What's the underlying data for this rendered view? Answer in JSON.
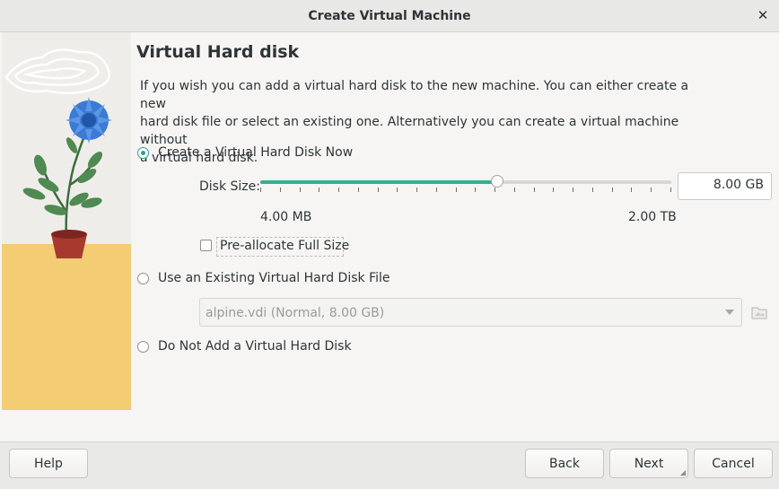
{
  "window": {
    "title": "Create Virtual Machine"
  },
  "page": {
    "title": "Virtual Hard disk",
    "description_lines": [
      "If you wish you can add a virtual hard disk to the new machine. You can either create a new",
      "hard disk file or select an existing one. Alternatively you can create a virtual machine without",
      "a virtual hard disk."
    ]
  },
  "options": {
    "create_new": {
      "label": "Create a Virtual Hard Disk Now",
      "selected": true
    },
    "use_existing": {
      "label": "Use an Existing Virtual Hard Disk File",
      "selected": false
    },
    "no_disk": {
      "label": "Do Not Add a Virtual Hard Disk",
      "selected": false
    }
  },
  "disk_size": {
    "label": "Disk Size:",
    "value": "8.00 GB",
    "min_label": "4.00 MB",
    "max_label": "2.00 TB",
    "slider_fraction": 0.577,
    "tick_count": 22
  },
  "preallocate": {
    "label": "Pre-allocate Full Size",
    "checked": false
  },
  "existing_file": {
    "selected": "alpine.vdi (Normal, 8.00 GB)"
  },
  "buttons": {
    "help": "Help",
    "back": "Back",
    "next": "Next",
    "cancel": "Cancel"
  },
  "colors": {
    "accent": "#33b08f",
    "radio_selected": "#2aa198",
    "art_yellow": "#f3cc73",
    "flower_blue": "#3a7bd5"
  }
}
